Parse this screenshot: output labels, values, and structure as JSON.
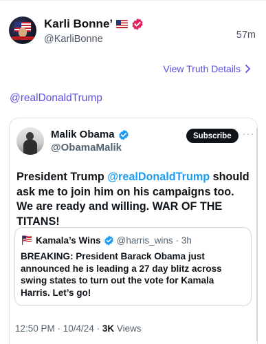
{
  "truth": {
    "author_name": "Karli Bonne’",
    "author_handle": "@KarliBonne",
    "time_ago": "57m",
    "view_details_label": "View Truth Details",
    "mention_text": "@realDonaldTrump"
  },
  "embedded_post": {
    "author_name": "Malik Obama",
    "author_handle": "@ObamaMalik",
    "subscribe_label": "Subscribe",
    "more_label": "···",
    "body_pre": "President Trump ",
    "body_mention": "@realDonaldTrump",
    "body_post": " should ask me to join him on his campaigns too. We are ready and willing. WAR OF THE TITANS!",
    "quote": {
      "author_name": "Kamala’s Wins",
      "author_handle": "@harris_wins",
      "time": "· 3h",
      "body": "BREAKING: President Barack Obama just announced he is leading a 27 day blitz across swing states to turn out the vote for Kamala Harris. Let’s go!"
    },
    "timestamp": "12:50 PM · 10/4/24 · ",
    "views_count": "3K",
    "views_label": " Views"
  },
  "colors": {
    "link_purple": "#5b4fe3",
    "twitter_blue": "#1d9bf0",
    "verified_red": "#e0245e"
  },
  "icons": [
    "us-flag-icon",
    "verified-red-icon",
    "chevron-right-icon",
    "verified-blue-icon",
    "american-flag-emoji-icon"
  ]
}
